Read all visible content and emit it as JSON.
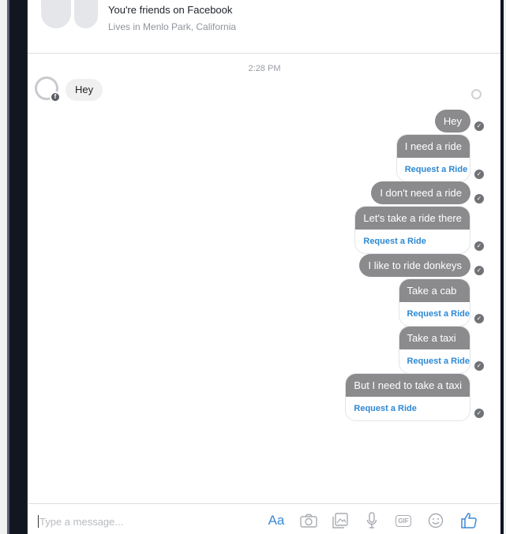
{
  "profile": {
    "friends_text": "You're friends on Facebook",
    "lives_text": "Lives in Menlo Park, California"
  },
  "conversation": {
    "timestamp": "2:28 PM",
    "received": {
      "text": "Hey",
      "avatar_badge": "f"
    },
    "sent": [
      {
        "text": "Hey"
      },
      {
        "text": "I need a ride",
        "action": "Request a Ride"
      },
      {
        "text": "I don't need a ride"
      },
      {
        "text": "Let's take a ride there",
        "action": "Request a Ride"
      },
      {
        "text": "I like to ride donkeys"
      },
      {
        "text": "Take a cab",
        "action": "Request a Ride"
      },
      {
        "text": "Take a taxi",
        "action": "Request a Ride"
      },
      {
        "text": "But I need to take a taxi",
        "action": "Request a Ride"
      }
    ]
  },
  "composer": {
    "placeholder": "Type a message...",
    "aa_label": "Aa",
    "gif_label": "GIF",
    "icons": [
      "camera-icon",
      "gallery-icon",
      "microphone-icon",
      "gif-icon",
      "emoji-icon",
      "thumbs-up-icon"
    ]
  },
  "colors": {
    "sent_bubble": "#8b8b8d",
    "received_bubble": "#f1f0f0",
    "link": "#2d88d4",
    "accent": "#3b8ad6"
  }
}
